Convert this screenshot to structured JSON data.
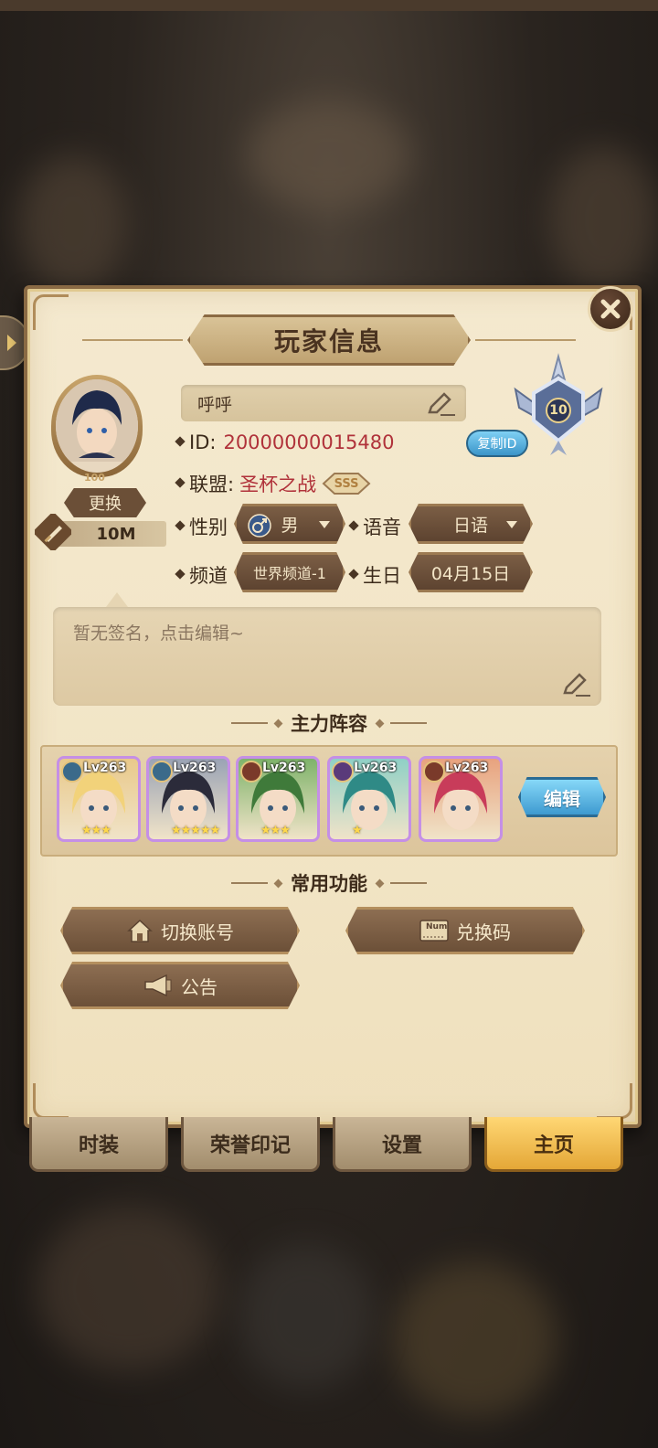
{
  "title": "玩家信息",
  "player": {
    "name": "呼呼",
    "id_label": "ID:",
    "id_value": "20000000015480",
    "copy_id_label": "复制ID",
    "alliance_label": "联盟:",
    "alliance_value": "圣杯之战",
    "alliance_badge": "SSS",
    "avatar_level": "100",
    "change_label": "更换",
    "power_value": "10M",
    "rank_number": "10"
  },
  "fields": {
    "gender_label": "性别",
    "gender_value": "男",
    "voice_label": "语音",
    "voice_value": "日语",
    "channel_label": "频道",
    "channel_value": "世界频道-1",
    "birthday_label": "生日",
    "birthday_value": "04月15日"
  },
  "signature": {
    "placeholder": "暂无签名，点击编辑~"
  },
  "lineup": {
    "title": "主力阵容",
    "edit_label": "编辑",
    "heroes": [
      {
        "level": "Lv263",
        "stars": 3,
        "hair_color": "#f2d27a",
        "bg": "#e9c98a"
      },
      {
        "level": "Lv263",
        "stars": 5,
        "hair_color": "#2b2b3a",
        "bg": "#9aa3b5"
      },
      {
        "level": "Lv263",
        "stars": 3,
        "hair_color": "#3f7a3a",
        "bg": "#7eb36a"
      },
      {
        "level": "Lv263",
        "stars": 1,
        "hair_color": "#2f8a86",
        "bg": "#8fd0c6"
      },
      {
        "level": "Lv263",
        "stars": 0,
        "hair_color": "#c83c5a",
        "bg": "#e8a27e"
      }
    ]
  },
  "functions": {
    "title": "常用功能",
    "switch_account": "切换账号",
    "redeem_code": "兑换码",
    "redeem_icon_text": "Num",
    "announcement": "公告"
  },
  "tabs": [
    {
      "label": "时装",
      "active": false
    },
    {
      "label": "荣誉印记",
      "active": false
    },
    {
      "label": "设置",
      "active": false
    },
    {
      "label": "主页",
      "active": true
    }
  ],
  "colors": {
    "panel_bg": "#f2e5c6",
    "accent_red": "#b0323a",
    "button_blue": "#3e9ad0",
    "tab_active": "#e4a737"
  }
}
